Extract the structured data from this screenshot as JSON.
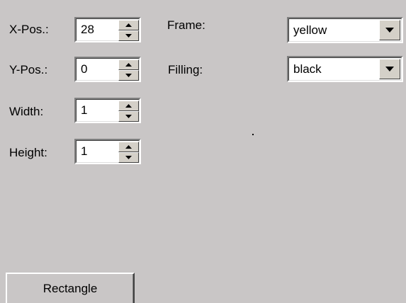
{
  "fields": {
    "x_pos": {
      "label": "X-Pos.:",
      "value": "28"
    },
    "y_pos": {
      "label": "Y-Pos.:",
      "value": "0"
    },
    "width": {
      "label": "Width:",
      "value": "1"
    },
    "height": {
      "label": "Height:",
      "value": "1"
    }
  },
  "selectors": {
    "frame": {
      "label": "Frame:",
      "value": "yellow"
    },
    "filling": {
      "label": "Filling:",
      "value": "black"
    }
  },
  "buttons": {
    "rectangle": "Rectangle"
  },
  "icons": {
    "spin_up": "arrow-up-icon",
    "spin_down": "arrow-down-icon",
    "dropdown": "chevron-down-icon"
  },
  "colors": {
    "background": "#c9c6c6",
    "face": "#d4d0c8",
    "field": "#ffffff"
  }
}
